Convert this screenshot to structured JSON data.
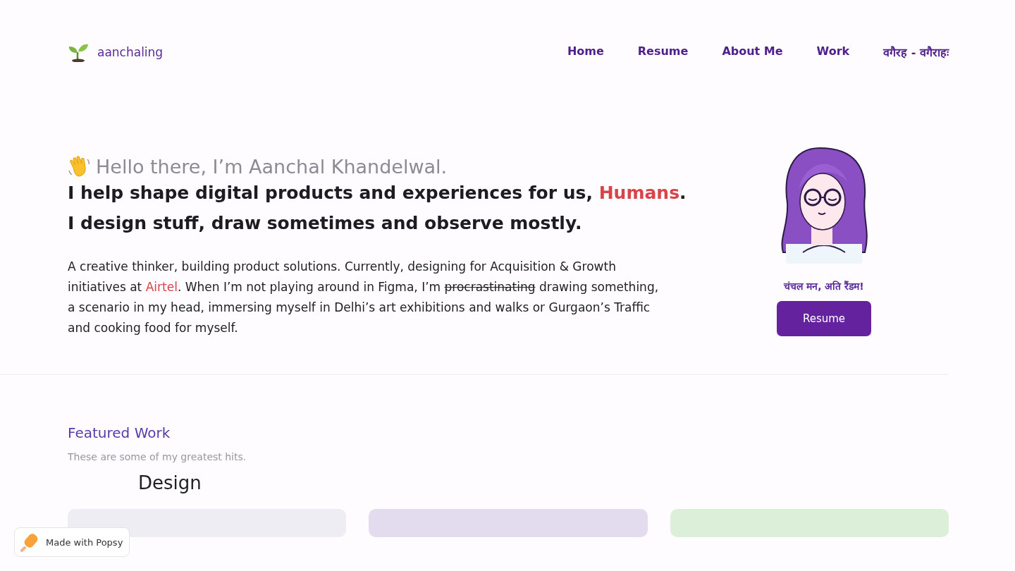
{
  "header": {
    "logo_text": "aanchaling",
    "nav": [
      {
        "label": "Home"
      },
      {
        "label": "Resume"
      },
      {
        "label": "About Me"
      },
      {
        "label": "Work"
      },
      {
        "label": "वगैरह - वगैराहः"
      }
    ]
  },
  "hero": {
    "greeting": "Hello there, I’m Aanchal Khandelwal.",
    "headline": [
      [
        {
          "kind": "plain",
          "text": "I help shape digital products and experiences for us, "
        },
        {
          "kind": "highlight",
          "text": "Humans"
        },
        {
          "kind": "plain",
          "text": "."
        }
      ],
      [
        {
          "kind": "plain",
          "text": "I design stuff, draw sometimes and observe mostly."
        }
      ]
    ],
    "bio": [
      {
        "kind": "plain",
        "text": "A creative thinker, building product solutions. Currently, designing for Acquisition & Growth initiatives at "
      },
      {
        "kind": "highlight",
        "text": "Airtel"
      },
      {
        "kind": "plain",
        "text": ". When I’m not playing around in Figma, I’m "
      },
      {
        "kind": "struck",
        "text": "procrastinating"
      },
      {
        "kind": "plain",
        "text": " drawing something, a scenario in my head, immersing myself in Delhi’s art exhibitions and walks or Gurgaon’s Traffic and cooking food for myself."
      }
    ],
    "tagline": "चंचल मन, अति रैंडम!",
    "button": "Resume"
  },
  "featured": {
    "title": "Featured Work",
    "subtitle": "These are some of my greatest hits.",
    "category": "Design",
    "cards": [
      {
        "color": "#eeedf3"
      },
      {
        "color": "#e3dcef"
      },
      {
        "color": "#dcefd9"
      }
    ]
  },
  "badge": {
    "label": "Made with Popsy"
  }
}
